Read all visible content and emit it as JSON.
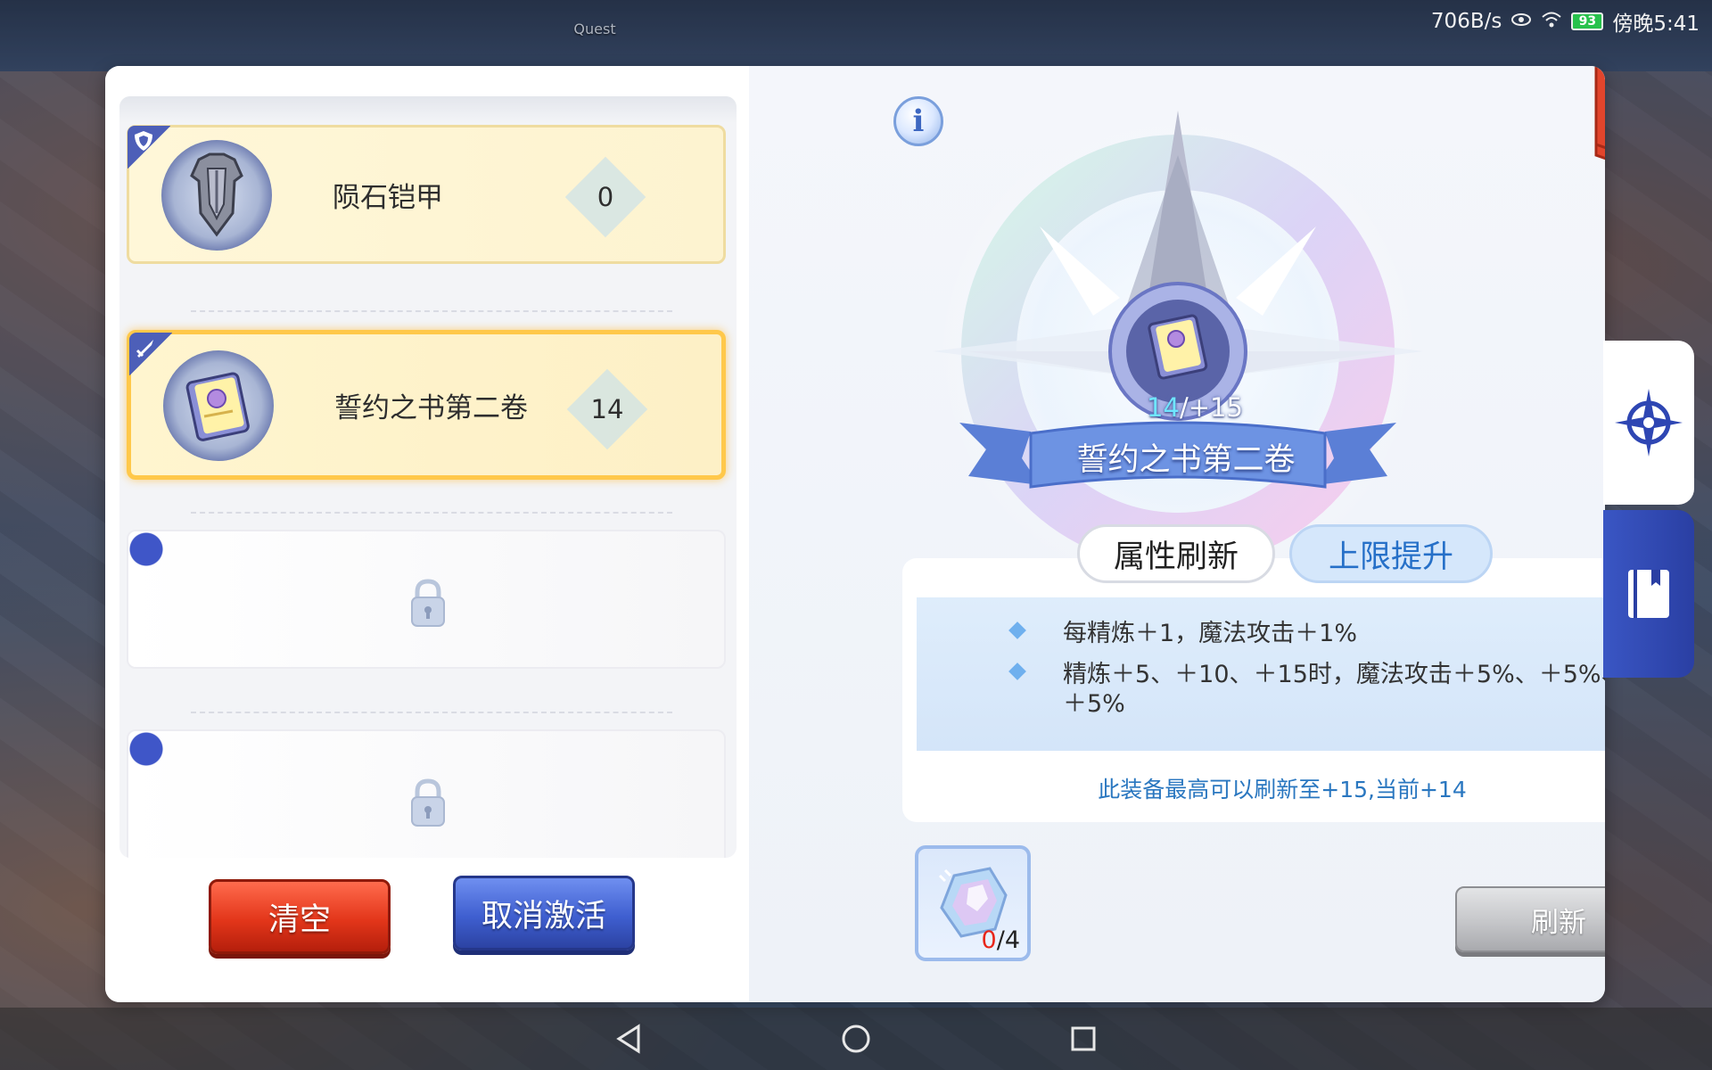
{
  "status_bar": {
    "net_speed": "706B/s",
    "battery": "93",
    "time": "傍晚5:41"
  },
  "background": {
    "quest_label": "Quest"
  },
  "left_panel": {
    "slots": [
      {
        "name": "陨石铠甲",
        "count": "0",
        "tag_icon": "shield-icon",
        "state": "filled"
      },
      {
        "name": "誓约之书第二卷",
        "count": "14",
        "tag_icon": "sword-icon",
        "state": "selected"
      },
      {
        "state": "locked"
      },
      {
        "state": "locked"
      }
    ],
    "clear_label": "清空",
    "deactivate_label": "取消激活"
  },
  "detail": {
    "item_name": "誓约之书第二卷",
    "level_current": "14",
    "level_max": "/+15",
    "tabs": [
      {
        "label": "属性刷新",
        "active": false
      },
      {
        "label": "上限提升",
        "active": true
      }
    ],
    "effects": [
      "每精炼＋1，魔法攻击＋1%",
      "精炼＋5、＋10、＋15时，魔法攻击＋5%、＋5%、＋5%"
    ],
    "note": "此装备最高可以刷新至+15,当前+14",
    "material": {
      "have": "0",
      "need": "/4"
    },
    "refresh_label": "刷新"
  },
  "colors": {
    "accent_blue": "#3f5fd0",
    "clear_red": "#e3361a",
    "selected_border": "#ffc84a",
    "note_blue": "#2a77c0"
  }
}
